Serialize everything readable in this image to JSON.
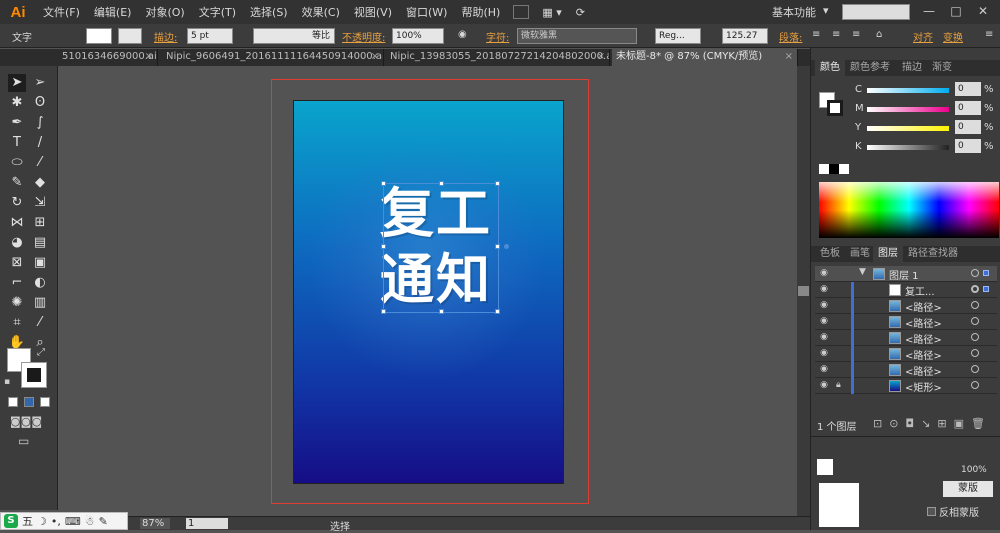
{
  "menubar": {
    "logo": "Ai",
    "items": [
      "文件(F)",
      "编辑(E)",
      "对象(O)",
      "文字(T)",
      "选择(S)",
      "效果(C)",
      "视图(V)",
      "窗口(W)",
      "帮助(H)"
    ],
    "workspace": "基本功能",
    "window_buttons": [
      "—",
      "□",
      "✕"
    ]
  },
  "control": {
    "tool_label": "文字",
    "stroke_label": "描边:",
    "stroke_value": "5 pt",
    "stroke_profile": "等比",
    "opacity_label": "不透明度:",
    "opacity_value": "100%",
    "char_label": "字符:",
    "font_value": "微软雅黑",
    "style_value": "Reg...",
    "size_value": "125.27",
    "para_label": "段落:",
    "align_label": "对齐",
    "transform_label": "变换"
  },
  "tabs": [
    {
      "label": "5101634669000.ai*",
      "active": false
    },
    {
      "label": "Nipic_9606491_20161111164450914000.ai*",
      "active": false
    },
    {
      "label": "Nipic_13983055_20180727214204802000.ai*",
      "active": false
    },
    {
      "label": "未标题-8* @ 87% (CMYK/预览)",
      "active": true
    }
  ],
  "artboard": {
    "headline_line1": "复工",
    "headline_line2": "通知",
    "gradient_colors": [
      "#0aa4cc",
      "#0d6fc1",
      "#1135a5",
      "#160d86"
    ]
  },
  "statusbar": {
    "zoom": "87%",
    "page": "1",
    "tool": "选择"
  },
  "ime": {
    "label": "五"
  },
  "color_panel": {
    "tabs": [
      "颜色",
      "颜色参考",
      "描边",
      "渐变"
    ],
    "channels": [
      {
        "name": "C",
        "value": "0",
        "unit": "%",
        "color": "#00aeef"
      },
      {
        "name": "M",
        "value": "0",
        "unit": "%",
        "color": "#ec008c"
      },
      {
        "name": "Y",
        "value": "0",
        "unit": "%",
        "color": "#fff200"
      },
      {
        "name": "K",
        "value": "0",
        "unit": "%",
        "color": "#777777"
      }
    ]
  },
  "layers_panel": {
    "tabs": [
      "色板",
      "画笔",
      "图层",
      "路径查找器"
    ],
    "rows": [
      {
        "name": "图层 1",
        "top": true,
        "locked": false
      },
      {
        "name": "复工...",
        "top": false,
        "locked": false
      },
      {
        "name": "<路径>",
        "top": false,
        "locked": false
      },
      {
        "name": "<路径>",
        "top": false,
        "locked": false
      },
      {
        "name": "<路径>",
        "top": false,
        "locked": false
      },
      {
        "name": "<路径>",
        "top": false,
        "locked": false
      },
      {
        "name": "<路径>",
        "top": false,
        "locked": false
      },
      {
        "name": "<矩形>",
        "top": false,
        "locked": true
      }
    ],
    "footer": "1 个图层"
  },
  "bottom_panel": {
    "badge": "蒙版",
    "checkbox_label": "反相蒙版",
    "percent": "100%"
  }
}
